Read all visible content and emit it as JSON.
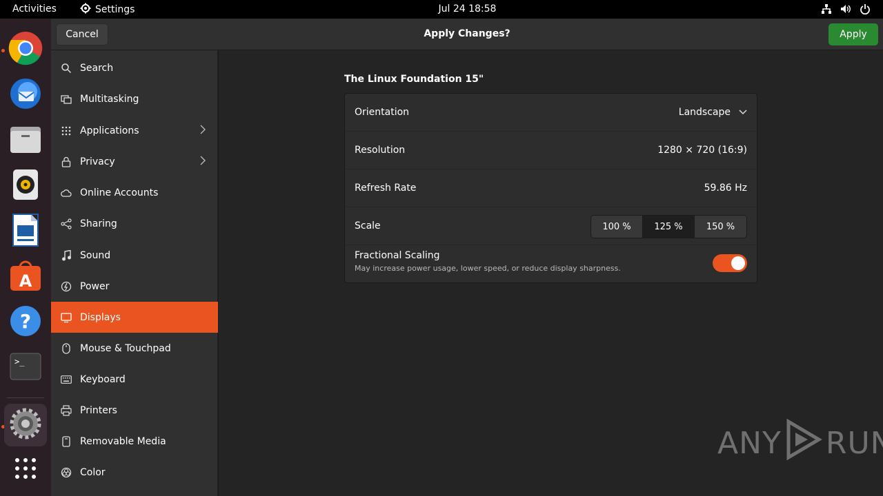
{
  "topbar": {
    "activities": "Activities",
    "app_name": "Settings",
    "clock": "Jul 24  18:58",
    "tray_icons": [
      "network-icon",
      "volume-icon",
      "power-icon"
    ]
  },
  "dock": {
    "items": [
      "chrome",
      "thunderbird",
      "files",
      "rhythmbox",
      "libreoffice-writer",
      "app-center",
      "help",
      "terminal",
      "settings",
      "show-apps"
    ],
    "accent": "#e95420"
  },
  "header": {
    "cancel_label": "Cancel",
    "title": "Apply Changes?",
    "apply_label": "Apply",
    "apply_color": "#2a8a32"
  },
  "sidebar": {
    "items": [
      {
        "label": "Search",
        "icon": "search-icon"
      },
      {
        "label": "Multitasking",
        "icon": "multitasking-icon"
      },
      {
        "label": "Applications",
        "icon": "grid-icon",
        "chevron": true
      },
      {
        "label": "Privacy",
        "icon": "lock-icon",
        "chevron": true
      },
      {
        "label": "Online Accounts",
        "icon": "cloud-icon"
      },
      {
        "label": "Sharing",
        "icon": "share-icon"
      },
      {
        "label": "Sound",
        "icon": "music-icon"
      },
      {
        "label": "Power",
        "icon": "power-icon"
      },
      {
        "label": "Displays",
        "icon": "display-icon",
        "selected": true
      },
      {
        "label": "Mouse & Touchpad",
        "icon": "mouse-icon"
      },
      {
        "label": "Keyboard",
        "icon": "keyboard-icon"
      },
      {
        "label": "Printers",
        "icon": "printer-icon"
      },
      {
        "label": "Removable Media",
        "icon": "media-icon"
      },
      {
        "label": "Color",
        "icon": "color-icon"
      }
    ],
    "selected_color": "#e95420"
  },
  "display": {
    "monitor_name": "The Linux Foundation 15\"",
    "orientation_label": "Orientation",
    "orientation_value": "Landscape",
    "resolution_label": "Resolution",
    "resolution_value": "1280 × 720 (16:9)",
    "refresh_label": "Refresh Rate",
    "refresh_value": "59.86 Hz",
    "scale_label": "Scale",
    "scale_options": [
      "100 %",
      "125 %",
      "150 %"
    ],
    "scale_selected": "125 %",
    "fractional_label": "Fractional Scaling",
    "fractional_sub": "May increase power usage, lower speed, or reduce display sharpness.",
    "fractional_enabled": true
  },
  "watermark": {
    "left": "ANY",
    "right": "RUN"
  }
}
